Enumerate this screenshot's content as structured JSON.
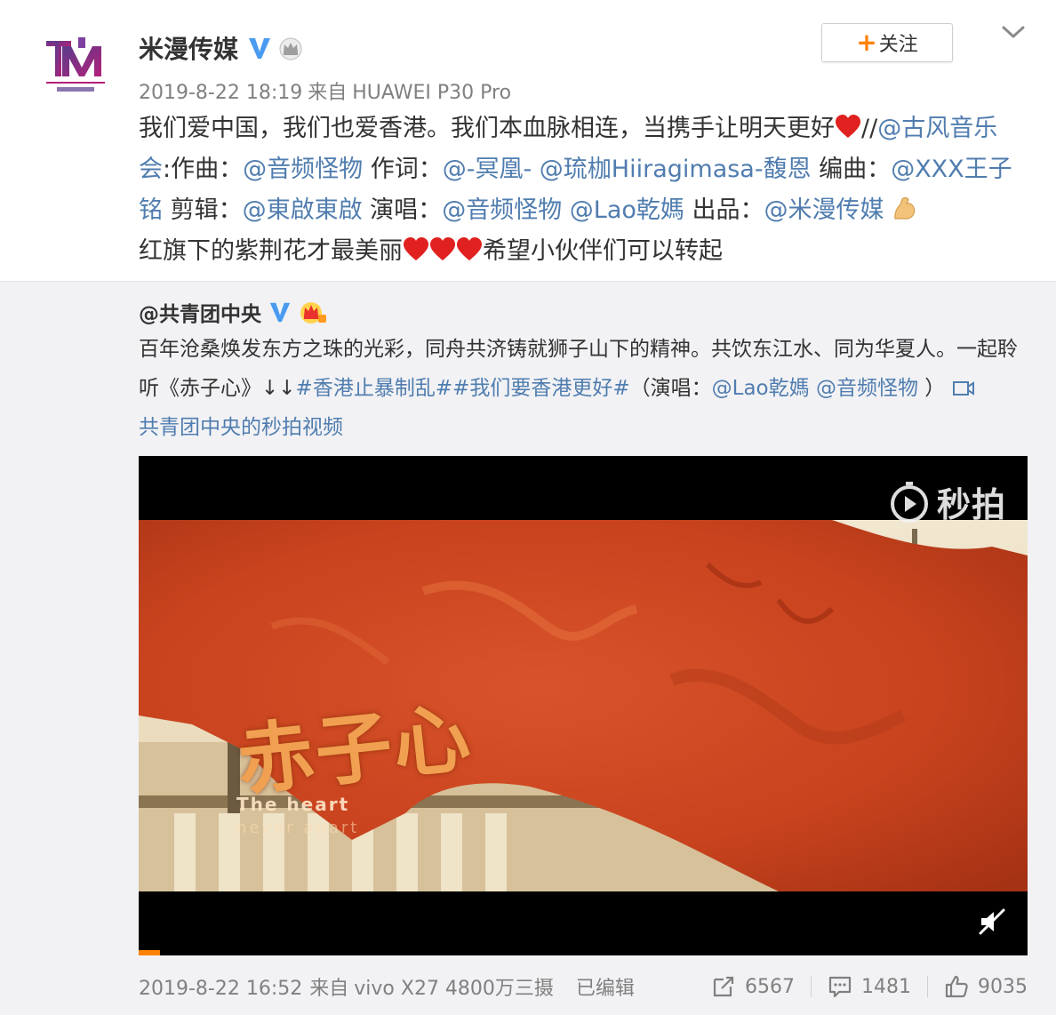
{
  "post": {
    "author": "米漫传媒",
    "timestamp": "2019-8-22 18:19",
    "source_prefix": "来自",
    "device": "HUAWEI P30 Pro",
    "follow_label": "关注",
    "text_segments": {
      "s1": "我们爱中国，我们也爱香港。我们本血脉相连，当携手让明天更好",
      "s2": "//",
      "m1": "@古风音乐会",
      "s3": ":作曲：",
      "m2": "@音频怪物",
      "s4": " 作词：",
      "m3": "@-冥凰-",
      "s5": " ",
      "m4": "@琉枷Hiiragimasa-馥恩",
      "s6": " 编曲：",
      "m5": "@XXX王子铭",
      "s7": " 剪辑：",
      "m6": "@東啟東啟",
      "s8": " 演唱：",
      "m7": "@音频怪物",
      "s9": " ",
      "m8": "@Lao乾媽",
      "s10": " 出品：",
      "m9": "@米漫传媒",
      "s11": "红旗下的紫荆花才最美丽",
      "s12": "希望小伙伴们可以转起"
    }
  },
  "repost": {
    "author": "@共青团中央",
    "text_segments": {
      "s1": "百年沧桑焕发东方之珠的光彩，同舟共济铸就狮子山下的精神。共饮东江水、同为华夏人。一起聆听《赤子心》↓↓",
      "h1": "#香港止暴制乱#",
      "h2": "#我们要香港更好#",
      "s2": "（演唱：",
      "m1": "@Lao乾媽",
      "s3": " ",
      "m2": "@音频怪物",
      "s4": " ）",
      "video_link": "共青团中央的秒拍视频"
    },
    "video": {
      "logo_text": "秒拍",
      "title_cn": "赤子心",
      "subtitle_line1": "The heart",
      "subtitle_line2": "never apart",
      "progress_fraction": 0.024
    },
    "footer": {
      "timestamp": "2019-8-22 16:52",
      "source_prefix": "来自",
      "device": "vivo X27 4800万三摄",
      "edited_label": "已编辑",
      "reposts": "6567",
      "comments": "1481",
      "likes": "9035"
    }
  },
  "colors": {
    "link": "#507daf",
    "accent_orange": "#ff8200",
    "verified_blue": "#4a9bf0",
    "meta_gray": "#808080",
    "heart_red": "#e0211f"
  },
  "icons": [
    "logo-avatar",
    "verified-v-icon",
    "crown-icon",
    "plus-icon",
    "chevron-down-icon",
    "heart-emoji",
    "flex-muscle-emoji",
    "gold-crown-icon",
    "video-link-icon",
    "miaopai-play-icon",
    "mute-icon",
    "repost-icon",
    "comment-icon",
    "like-icon"
  ]
}
